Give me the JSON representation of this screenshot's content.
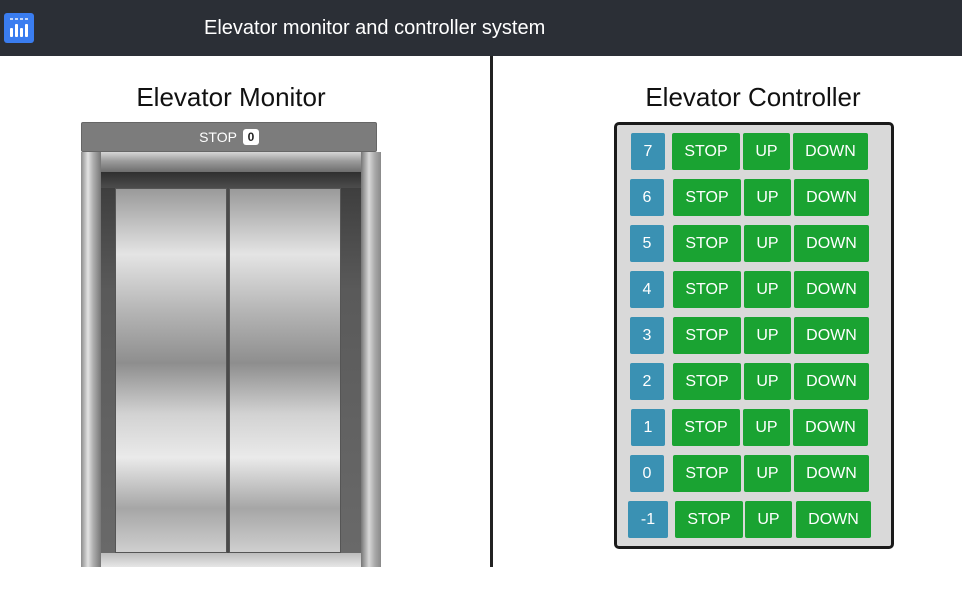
{
  "header": {
    "title": "Elevator monitor and controller system",
    "icon": "chart-bars-icon",
    "background": "#2b2f36"
  },
  "monitor": {
    "title": "Elevator Monitor",
    "status_label": "STOP",
    "current_floor": "0"
  },
  "controller": {
    "title": "Elevator Controller",
    "rows": [
      {
        "floor": "7",
        "stop": "STOP",
        "up": "UP",
        "down": "DOWN"
      },
      {
        "floor": "6",
        "stop": "STOP",
        "up": "UP",
        "down": "DOWN"
      },
      {
        "floor": "5",
        "stop": "STOP",
        "up": "UP",
        "down": "DOWN"
      },
      {
        "floor": "4",
        "stop": "STOP",
        "up": "UP",
        "down": "DOWN"
      },
      {
        "floor": "3",
        "stop": "STOP",
        "up": "UP",
        "down": "DOWN"
      },
      {
        "floor": "2",
        "stop": "STOP",
        "up": "UP",
        "down": "DOWN"
      },
      {
        "floor": "1",
        "stop": "STOP",
        "up": "UP",
        "down": "DOWN"
      },
      {
        "floor": "0",
        "stop": "STOP",
        "up": "UP",
        "down": "DOWN"
      },
      {
        "floor": "-1",
        "stop": "STOP",
        "up": "UP",
        "down": "DOWN"
      }
    ]
  },
  "colors": {
    "floor_button": "#3a91b3",
    "action_button": "#1aa332",
    "panel_background": "#d9d9d9"
  }
}
